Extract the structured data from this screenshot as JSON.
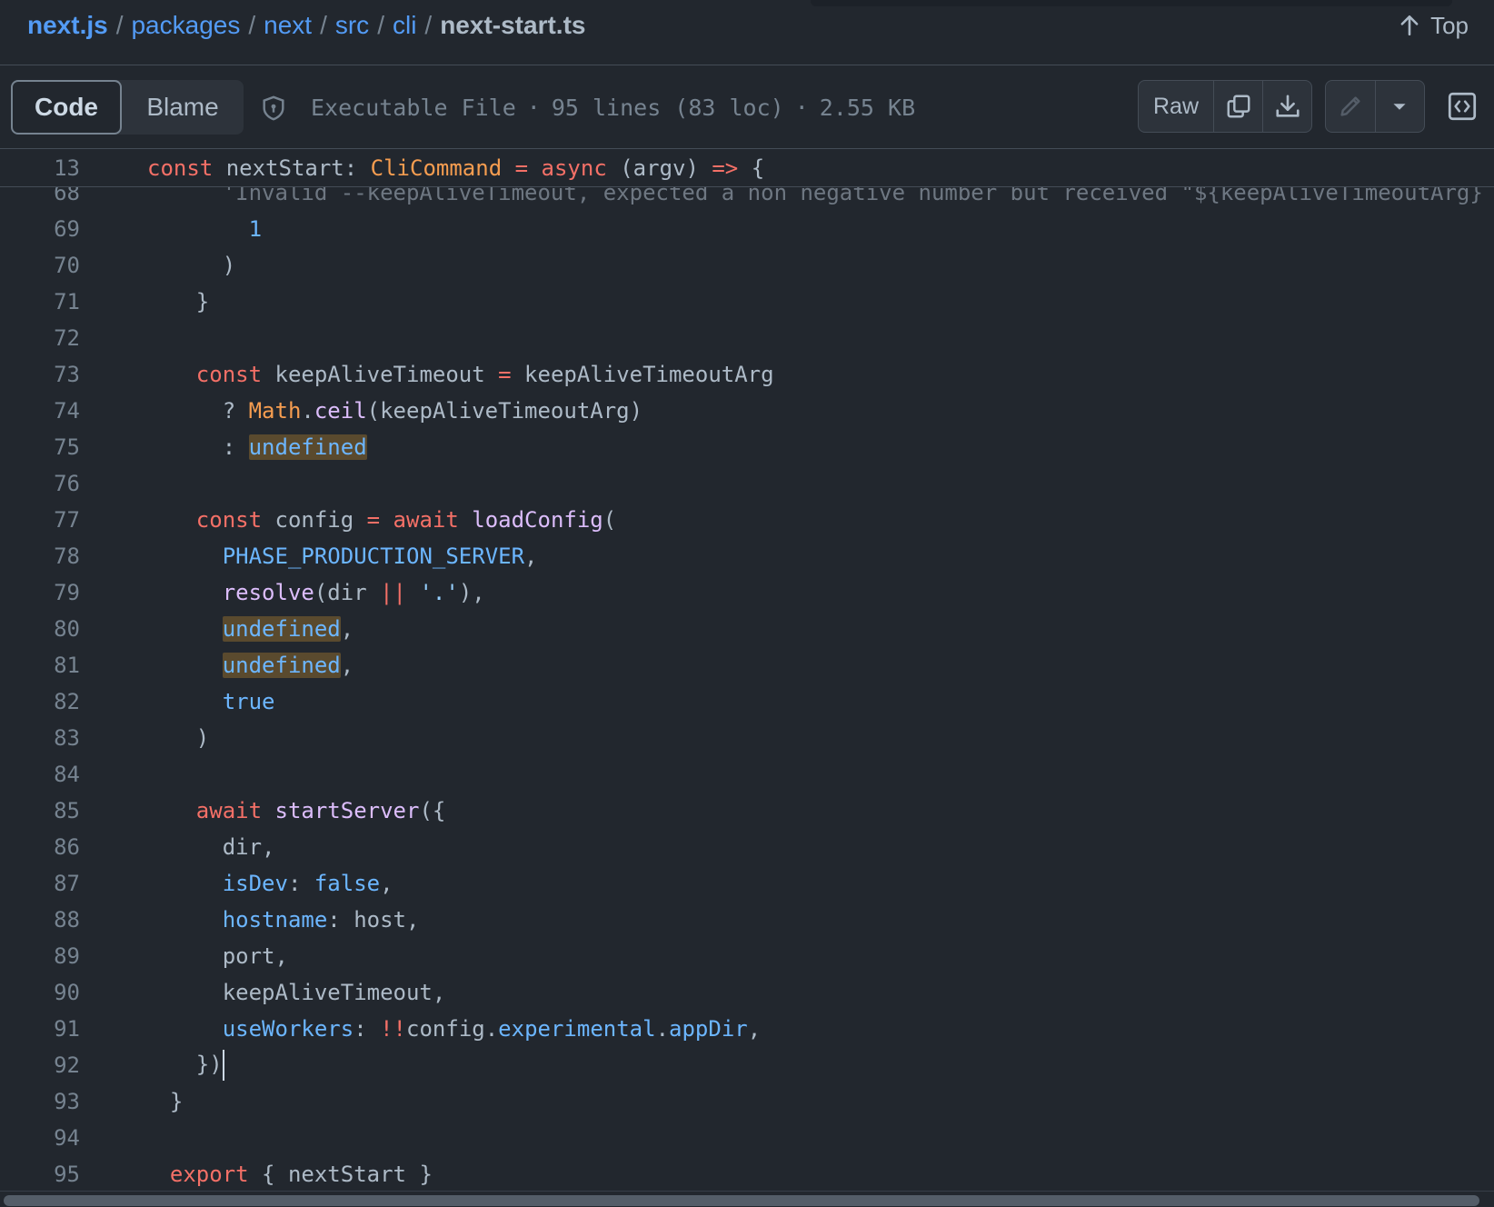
{
  "breadcrumb": {
    "repo": "next.js",
    "path": [
      "packages",
      "next",
      "src",
      "cli"
    ],
    "separator": "/",
    "file": "next-start.ts"
  },
  "top_link": "Top",
  "toolbar": {
    "code_tab": "Code",
    "blame_tab": "Blame",
    "file_type": "Executable File",
    "lines_info": "95 lines (83 loc)",
    "size": "2.55 KB",
    "raw_label": "Raw",
    "dot": "·"
  },
  "icons": {
    "top": "arrow-up-icon",
    "shield": "shield-icon",
    "copy": "copy-icon",
    "download": "download-icon",
    "edit": "pencil-icon",
    "dropdown": "triangle-down-icon",
    "symbols": "code-square-icon"
  },
  "colors": {
    "background": "#22272e",
    "keyword": "#f47067",
    "function": "#dcbdfb",
    "constant": "#6cb6ff",
    "type": "#f69d50",
    "string": "#96d0ff",
    "link": "#539bf5",
    "highlight": "#5a4a2e"
  },
  "sticky_line": {
    "number": "13",
    "tokens": [
      {
        "t": "const ",
        "c": "k"
      },
      {
        "t": "nextStart: ",
        "c": ""
      },
      {
        "t": "CliCommand",
        "c": "t"
      },
      {
        "t": " = ",
        "c": "k"
      },
      {
        "t": "async",
        "c": "k"
      },
      {
        "t": " (argv) ",
        "c": ""
      },
      {
        "t": "=>",
        "c": "k"
      },
      {
        "t": " {",
        "c": ""
      }
    ]
  },
  "partial_line": {
    "number": "68",
    "text": "      'Invalid --keepAliveTimeout, expected a non negative number but received \"${keepAliveTimeoutArg}"
  },
  "lines": [
    {
      "n": "69",
      "tokens": [
        {
          "t": "        ",
          "c": ""
        },
        {
          "t": "1",
          "c": "c"
        }
      ]
    },
    {
      "n": "70",
      "tokens": [
        {
          "t": "      )",
          "c": ""
        }
      ]
    },
    {
      "n": "71",
      "tokens": [
        {
          "t": "    }",
          "c": ""
        }
      ]
    },
    {
      "n": "72",
      "tokens": []
    },
    {
      "n": "73",
      "tokens": [
        {
          "t": "    ",
          "c": ""
        },
        {
          "t": "const",
          "c": "k"
        },
        {
          "t": " keepAliveTimeout ",
          "c": ""
        },
        {
          "t": "=",
          "c": "k"
        },
        {
          "t": " keepAliveTimeoutArg",
          "c": ""
        }
      ]
    },
    {
      "n": "74",
      "tokens": [
        {
          "t": "      ? ",
          "c": ""
        },
        {
          "t": "Math",
          "c": "t"
        },
        {
          "t": ".",
          "c": ""
        },
        {
          "t": "ceil",
          "c": "f"
        },
        {
          "t": "(keepAliveTimeoutArg)",
          "c": ""
        }
      ]
    },
    {
      "n": "75",
      "tokens": [
        {
          "t": "      : ",
          "c": ""
        },
        {
          "t": "undefined",
          "c": "c hl"
        }
      ]
    },
    {
      "n": "76",
      "tokens": []
    },
    {
      "n": "77",
      "tokens": [
        {
          "t": "    ",
          "c": ""
        },
        {
          "t": "const",
          "c": "k"
        },
        {
          "t": " config ",
          "c": ""
        },
        {
          "t": "=",
          "c": "k"
        },
        {
          "t": " ",
          "c": ""
        },
        {
          "t": "await",
          "c": "k"
        },
        {
          "t": " ",
          "c": ""
        },
        {
          "t": "loadConfig",
          "c": "f"
        },
        {
          "t": "(",
          "c": ""
        }
      ]
    },
    {
      "n": "78",
      "tokens": [
        {
          "t": "      ",
          "c": ""
        },
        {
          "t": "PHASE_PRODUCTION_SERVER",
          "c": "c"
        },
        {
          "t": ",",
          "c": ""
        }
      ]
    },
    {
      "n": "79",
      "tokens": [
        {
          "t": "      ",
          "c": ""
        },
        {
          "t": "resolve",
          "c": "f"
        },
        {
          "t": "(dir ",
          "c": ""
        },
        {
          "t": "||",
          "c": "k"
        },
        {
          "t": " ",
          "c": ""
        },
        {
          "t": "'.'",
          "c": "s"
        },
        {
          "t": "),",
          "c": ""
        }
      ]
    },
    {
      "n": "80",
      "tokens": [
        {
          "t": "      ",
          "c": ""
        },
        {
          "t": "undefined",
          "c": "c hl"
        },
        {
          "t": ",",
          "c": ""
        }
      ]
    },
    {
      "n": "81",
      "tokens": [
        {
          "t": "      ",
          "c": ""
        },
        {
          "t": "undefined",
          "c": "c hl"
        },
        {
          "t": ",",
          "c": ""
        }
      ]
    },
    {
      "n": "82",
      "tokens": [
        {
          "t": "      ",
          "c": ""
        },
        {
          "t": "true",
          "c": "c"
        }
      ]
    },
    {
      "n": "83",
      "tokens": [
        {
          "t": "    )",
          "c": ""
        }
      ]
    },
    {
      "n": "84",
      "tokens": []
    },
    {
      "n": "85",
      "tokens": [
        {
          "t": "    ",
          "c": ""
        },
        {
          "t": "await",
          "c": "k"
        },
        {
          "t": " ",
          "c": ""
        },
        {
          "t": "startServer",
          "c": "f"
        },
        {
          "t": "({",
          "c": ""
        }
      ]
    },
    {
      "n": "86",
      "tokens": [
        {
          "t": "      dir,",
          "c": ""
        }
      ]
    },
    {
      "n": "87",
      "tokens": [
        {
          "t": "      ",
          "c": ""
        },
        {
          "t": "isDev",
          "c": "c"
        },
        {
          "t": ": ",
          "c": ""
        },
        {
          "t": "false",
          "c": "c"
        },
        {
          "t": ",",
          "c": ""
        }
      ]
    },
    {
      "n": "88",
      "tokens": [
        {
          "t": "      ",
          "c": ""
        },
        {
          "t": "hostname",
          "c": "c"
        },
        {
          "t": ": host,",
          "c": ""
        }
      ]
    },
    {
      "n": "89",
      "tokens": [
        {
          "t": "      port,",
          "c": ""
        }
      ]
    },
    {
      "n": "90",
      "tokens": [
        {
          "t": "      keepAliveTimeout,",
          "c": ""
        }
      ]
    },
    {
      "n": "91",
      "tokens": [
        {
          "t": "      ",
          "c": ""
        },
        {
          "t": "useWorkers",
          "c": "c"
        },
        {
          "t": ": ",
          "c": ""
        },
        {
          "t": "!!",
          "c": "k"
        },
        {
          "t": "config.",
          "c": ""
        },
        {
          "t": "experimental",
          "c": "c"
        },
        {
          "t": ".",
          "c": ""
        },
        {
          "t": "appDir",
          "c": "c"
        },
        {
          "t": ",",
          "c": ""
        }
      ]
    },
    {
      "n": "92",
      "tokens": [
        {
          "t": "    })",
          "c": ""
        }
      ],
      "cursor": true
    },
    {
      "n": "93",
      "tokens": [
        {
          "t": "  }",
          "c": ""
        }
      ]
    },
    {
      "n": "94",
      "tokens": []
    },
    {
      "n": "95",
      "tokens": [
        {
          "t": "  ",
          "c": ""
        },
        {
          "t": "export",
          "c": "k"
        },
        {
          "t": " { nextStart }",
          "c": ""
        }
      ]
    }
  ]
}
